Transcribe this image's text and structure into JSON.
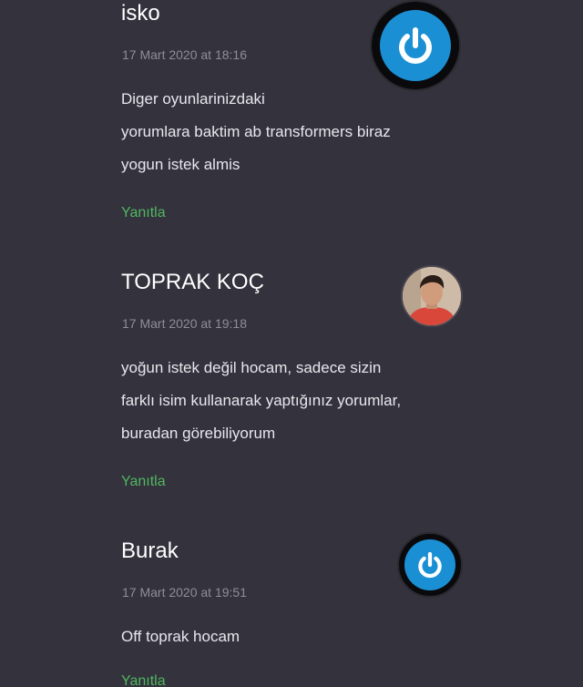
{
  "comments": [
    {
      "author": "isko",
      "date": "17 Mart 2020 at 18:16",
      "lines": [
        "Diger oyunlarinizdaki",
        "yorumlara baktim ab transformers biraz",
        "yogun istek almis"
      ],
      "reply_label": "Yanıtla",
      "avatar": "power-icon-avatar"
    },
    {
      "author": "TOPRAK KOÇ",
      "date": "17 Mart 2020 at 19:18",
      "lines": [
        "yoğun istek değil hocam, sadece sizin",
        "farklı isim kullanarak yaptığınız yorumlar,",
        "buradan görebiliyorum"
      ],
      "reply_label": "Yanıtla",
      "avatar": "profile-photo-avatar"
    },
    {
      "author": "Burak",
      "date": "17 Mart 2020 at 19:51",
      "lines": [
        "Off toprak hocam"
      ],
      "reply_label": "Yanıtla",
      "avatar": "power-icon-avatar"
    }
  ],
  "colors": {
    "background": "#34323d",
    "reply_link": "#4fb85e",
    "date_text": "#8f8d96",
    "avatar_accent": "#1b8fd4"
  }
}
